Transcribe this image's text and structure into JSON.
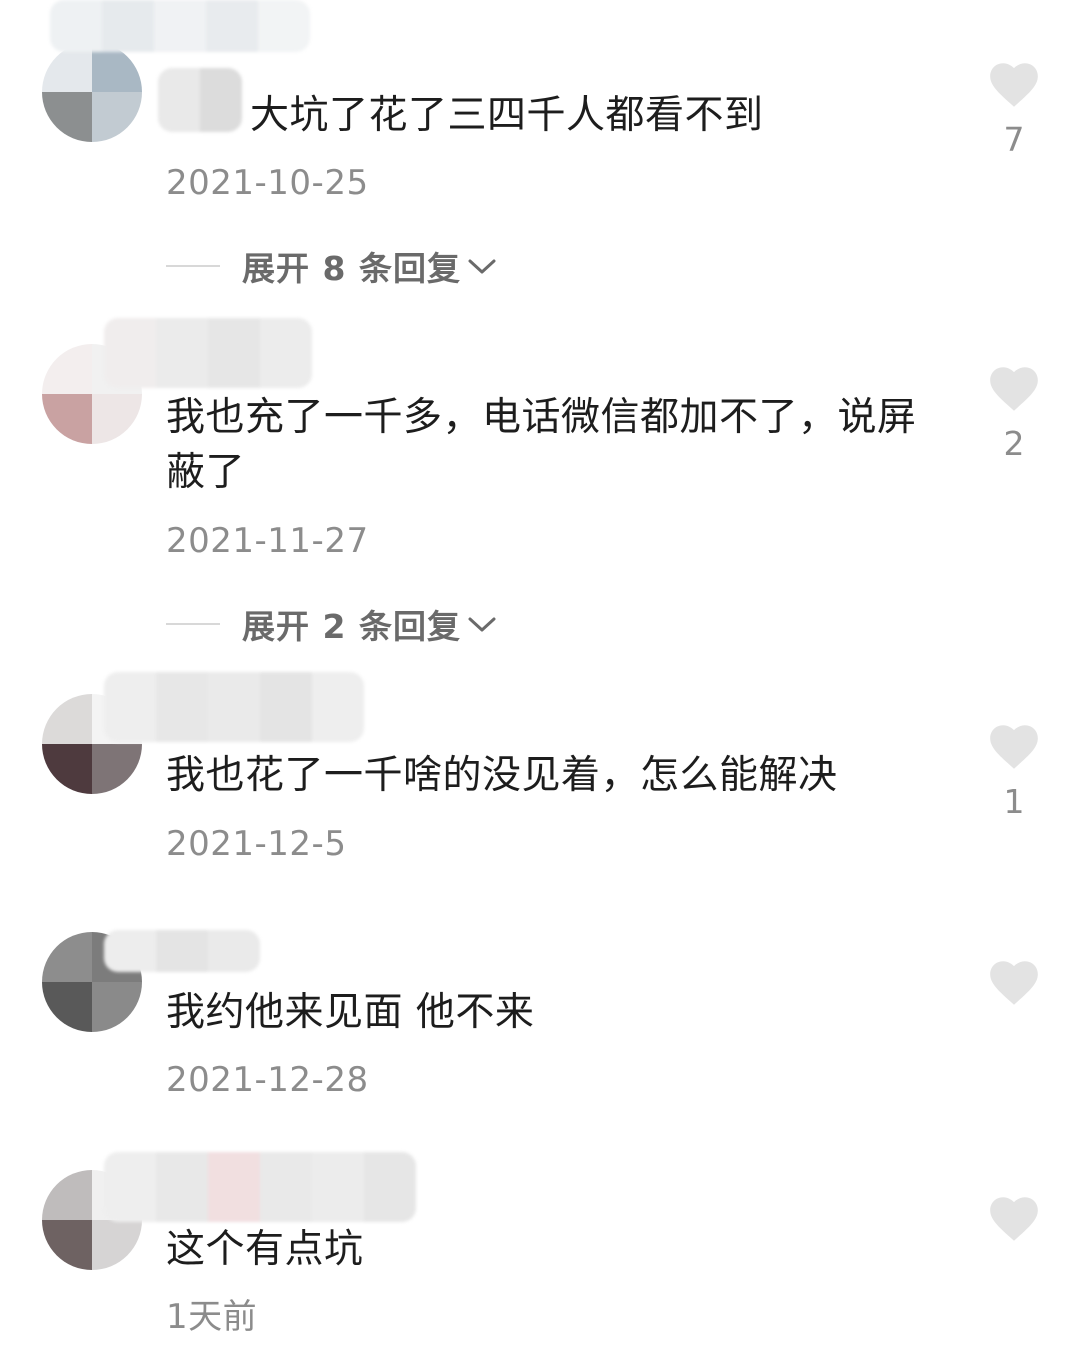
{
  "colors": {
    "text": "#1d1d1d",
    "meta": "#8c8c8c",
    "heart": "#e3e3e3",
    "expand": "#6a6a6a"
  },
  "comments": [
    {
      "text": "大坑了花了三四千人都看不到",
      "date": "2021-10-25",
      "likes": "7",
      "expand_label": "展开 8 条回复",
      "icon": "heart-icon"
    },
    {
      "text": "我也充了一千多，电话微信都加不了，说屏蔽了",
      "date": "2021-11-27",
      "likes": "2",
      "expand_label": "展开 2 条回复",
      "icon": "heart-icon"
    },
    {
      "text": "我也花了一千啥的没见着，怎么能解决",
      "date": "2021-12-5",
      "likes": "1",
      "icon": "heart-icon"
    },
    {
      "text": "我约他来见面 他不来",
      "date": "2021-12-28",
      "likes": "",
      "icon": "heart-icon"
    },
    {
      "text": "这个有点坑",
      "date": "1天前",
      "likes": "",
      "icon": "heart-icon"
    }
  ]
}
